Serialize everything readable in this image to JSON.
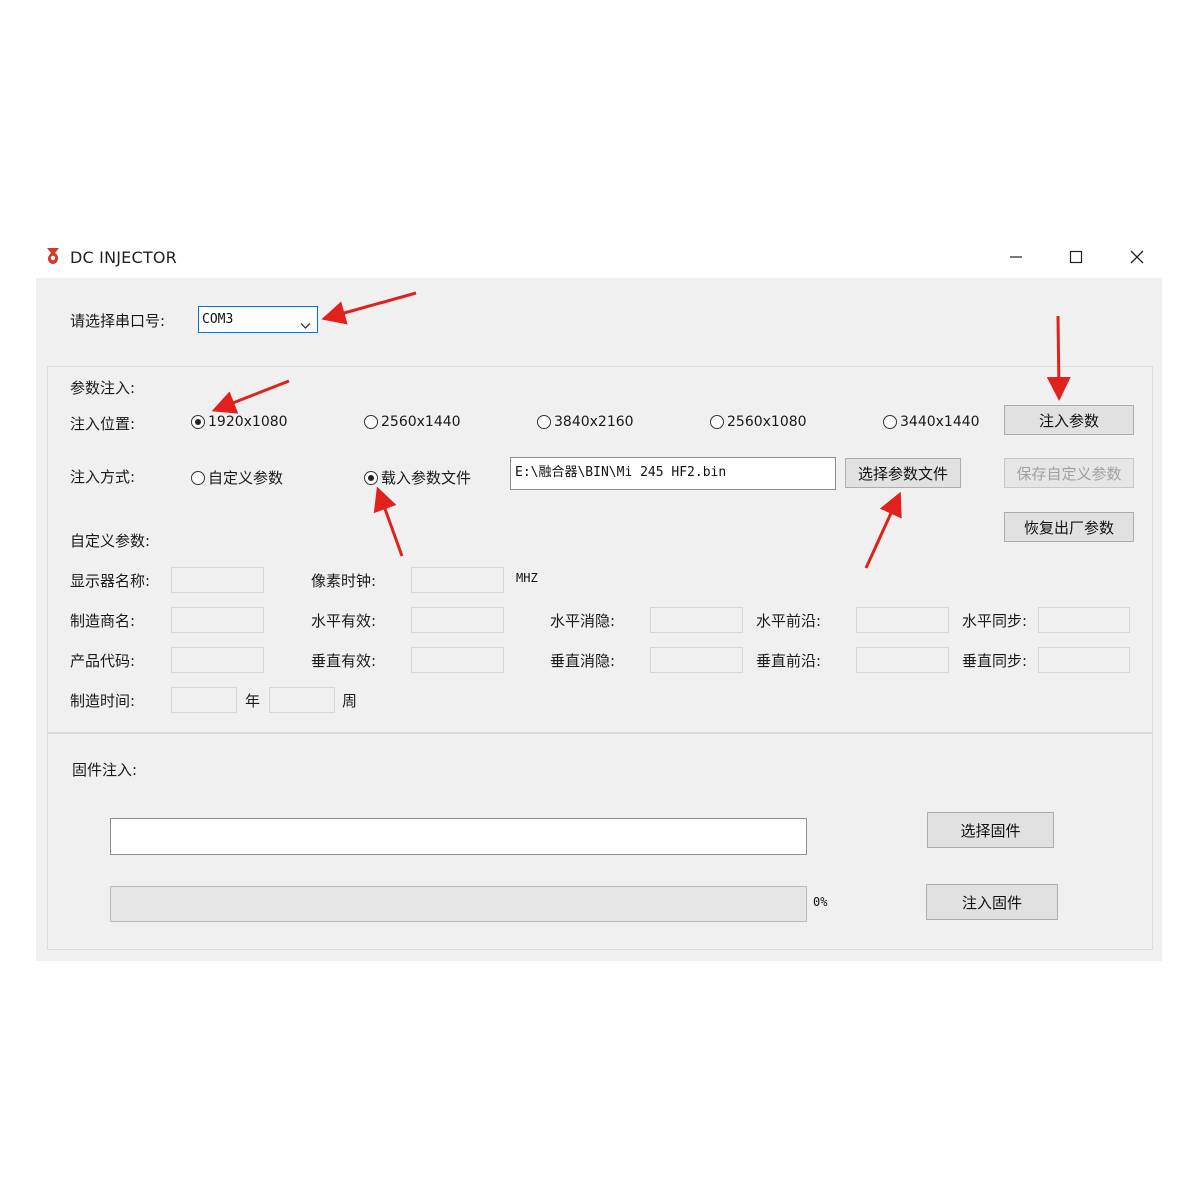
{
  "window": {
    "title": "DC INJECTOR"
  },
  "port": {
    "label": "请选择串口号:",
    "selected": "COM3"
  },
  "params": {
    "section_label": "参数注入:",
    "position_label": "注入位置:",
    "positions": [
      {
        "label": "1920x1080",
        "checked": true
      },
      {
        "label": "2560x1440",
        "checked": false
      },
      {
        "label": "3840x2160",
        "checked": false
      },
      {
        "label": "2560x1080",
        "checked": false
      },
      {
        "label": "3440x1440",
        "checked": false
      }
    ],
    "method_label": "注入方式:",
    "methods": [
      {
        "label": "自定义参数",
        "checked": false
      },
      {
        "label": "载入参数文件",
        "checked": true
      }
    ],
    "file_path": "E:\\融合器\\BIN\\Mi 245 HF2.bin",
    "select_file_button": "选择参数文件",
    "inject_button": "注入参数",
    "save_custom_button": "保存自定义参数",
    "restore_button": "恢复出厂参数"
  },
  "custom": {
    "section_label": "自定义参数:",
    "monitor_name_label": "显示器名称:",
    "pixel_clock_label": "像素时钟:",
    "pixel_clock_unit": "MHZ",
    "manufacturer_label": "制造商名:",
    "product_code_label": "产品代码:",
    "manufacture_time_label": "制造时间:",
    "year_label": "年",
    "week_label": "周",
    "h_active_label": "水平有效:",
    "v_active_label": "垂直有效:",
    "h_blank_label": "水平消隐:",
    "v_blank_label": "垂直消隐:",
    "h_front_label": "水平前沿:",
    "v_front_label": "垂直前沿:",
    "h_sync_label": "水平同步:",
    "v_sync_label": "垂直同步:"
  },
  "firmware": {
    "section_label": "固件注入:",
    "path": "",
    "select_button": "选择固件",
    "inject_button": "注入固件",
    "progress_percent": 0,
    "progress_text": "0%"
  },
  "colors": {
    "arrow": "#e0211c",
    "combo_border": "#0078d7",
    "logo": "#d43a2a"
  }
}
